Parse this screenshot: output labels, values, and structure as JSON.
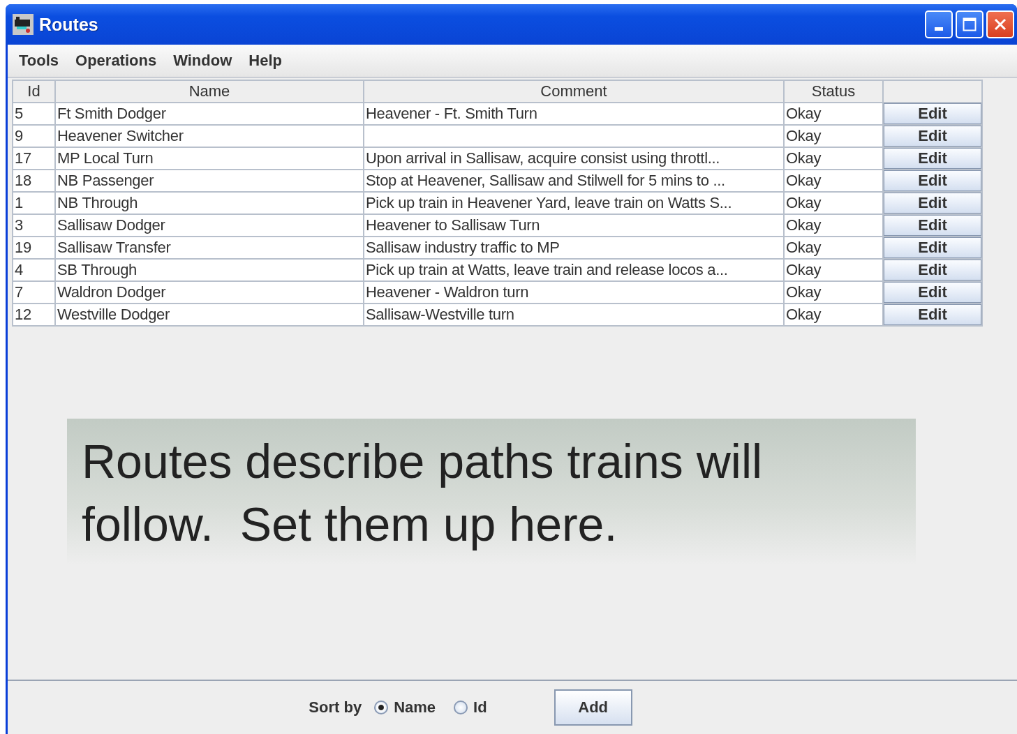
{
  "window": {
    "title": "Routes"
  },
  "menu": [
    "Tools",
    "Operations",
    "Window",
    "Help"
  ],
  "table": {
    "columns": [
      "Id",
      "Name",
      "Comment",
      "Status"
    ],
    "rows": [
      {
        "id": "5",
        "name": "Ft Smith Dodger",
        "comment": "Heavener - Ft. Smith Turn",
        "status": "Okay",
        "action": "Edit"
      },
      {
        "id": "9",
        "name": "Heavener Switcher",
        "comment": "",
        "status": "Okay",
        "action": "Edit"
      },
      {
        "id": "17",
        "name": "MP Local Turn",
        "comment": "Upon arrival in Sallisaw, acquire consist using throttl...",
        "status": "Okay",
        "action": "Edit"
      },
      {
        "id": "18",
        "name": "NB Passenger",
        "comment": "Stop at Heavener, Sallisaw and Stilwell for 5 mins to ...",
        "status": "Okay",
        "action": "Edit"
      },
      {
        "id": "1",
        "name": "NB Through",
        "comment": "Pick up train in Heavener Yard, leave train on Watts S...",
        "status": "Okay",
        "action": "Edit"
      },
      {
        "id": "3",
        "name": "Sallisaw Dodger",
        "comment": "Heavener to Sallisaw Turn",
        "status": "Okay",
        "action": "Edit"
      },
      {
        "id": "19",
        "name": "Sallisaw Transfer",
        "comment": "Sallisaw industry traffic to MP",
        "status": "Okay",
        "action": "Edit"
      },
      {
        "id": "4",
        "name": "SB Through",
        "comment": "Pick up train at Watts, leave train and release locos a...",
        "status": "Okay",
        "action": "Edit"
      },
      {
        "id": "7",
        "name": "Waldron Dodger",
        "comment": "Heavener - Waldron turn",
        "status": "Okay",
        "action": "Edit"
      },
      {
        "id": "12",
        "name": "Westville Dodger",
        "comment": "Sallisaw-Westville turn",
        "status": "Okay",
        "action": "Edit"
      }
    ]
  },
  "callout": "Routes describe paths trains will follow.  Set them up here.",
  "sort": {
    "label": "Sort by",
    "options": [
      {
        "label": "Name",
        "selected": true
      },
      {
        "label": "Id",
        "selected": false
      }
    ]
  },
  "add_button": "Add"
}
